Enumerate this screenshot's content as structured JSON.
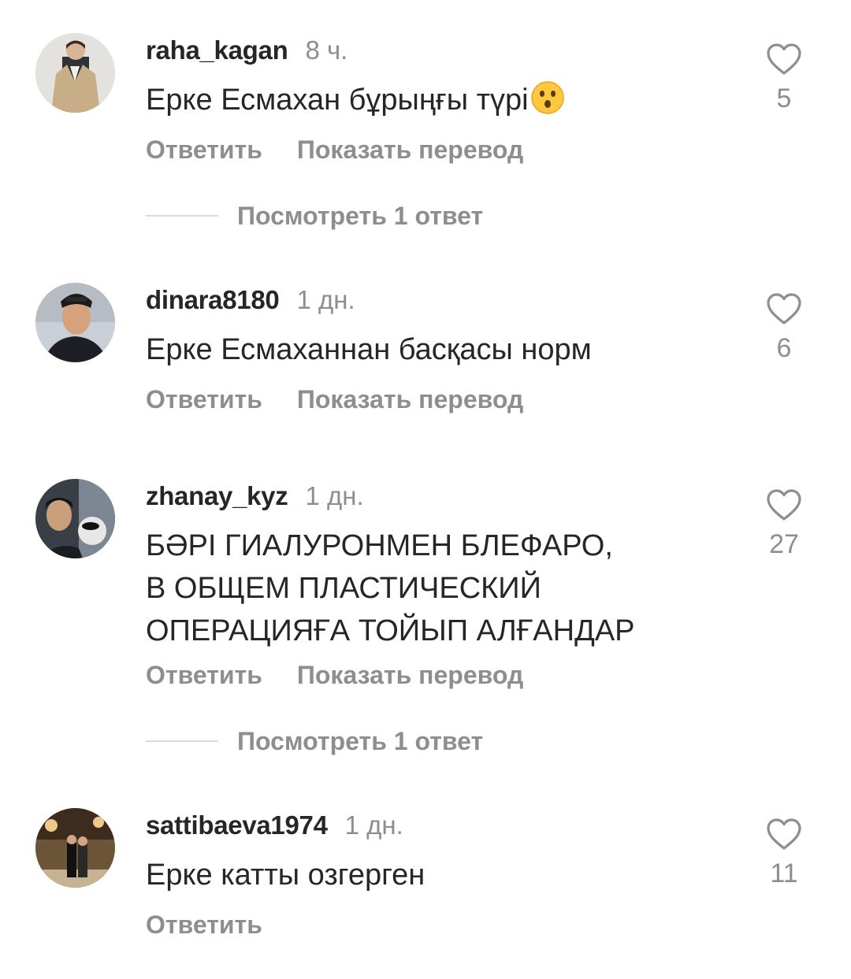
{
  "comments": [
    {
      "username": "raha_kagan",
      "time": "8 ч.",
      "text": "Ерке Есмахан бұрыңғы түрі",
      "emoji": "hushed-face-emoji",
      "likes": "5",
      "actions": {
        "reply": "Ответить",
        "translate": "Показать перевод"
      },
      "replies_label": "Посмотреть 1 ответ"
    },
    {
      "username": "dinara8180",
      "time": "1 дн.",
      "text": "Ерке Есмаханнан басқасы норм",
      "likes": "6",
      "actions": {
        "reply": "Ответить",
        "translate": "Показать перевод"
      }
    },
    {
      "username": "zhanay_kyz",
      "time": "1 дн.",
      "text_lines": [
        "БӘРІ ГИАЛУРОНМЕН  БЛЕФАРО,",
        "В ОБЩЕМ ПЛАСТИЧЕСКИЙ",
        "ОПЕРАЦИЯҒА ТОЙЫП АЛҒАНДАР"
      ],
      "likes": "27",
      "actions": {
        "reply": "Ответить",
        "translate": "Показать перевод"
      },
      "replies_label": "Посмотреть 1 ответ"
    },
    {
      "username": "sattibaeva1974",
      "time": "1 дн.",
      "text": "Ерке катты озгерген",
      "likes": "11",
      "actions": {
        "reply": "Ответить"
      }
    }
  ],
  "icons": {
    "like": "heart-outline-icon"
  },
  "colors": {
    "primary_text": "#262626",
    "secondary_text": "#8e8e8e",
    "divider": "#dbdbdb"
  }
}
